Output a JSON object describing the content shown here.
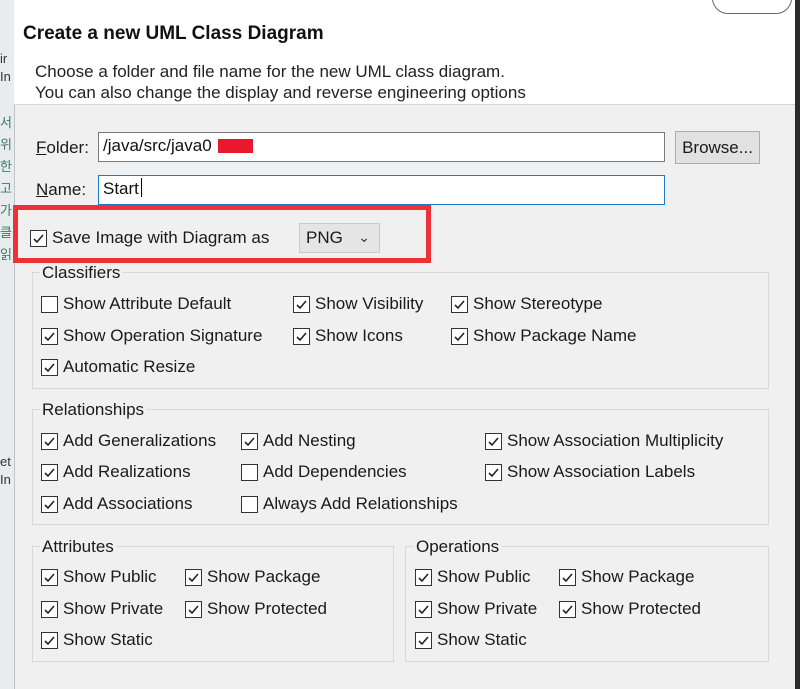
{
  "header": {
    "title": "Create a new UML Class Diagram",
    "desc_line1": "Choose a folder and file name for the new UML class diagram.",
    "desc_line2": "You can also change the display and reverse engineering options"
  },
  "folder": {
    "label_mnemonic": "F",
    "label_rest": "older:",
    "value": "/java/src/java0"
  },
  "name": {
    "label_mnemonic": "N",
    "label_rest": "ame:",
    "value": "Start"
  },
  "browse_label": "Browse...",
  "save_image": {
    "label": "Save Image with Diagram as",
    "checked": true,
    "format": "PNG"
  },
  "classifiers": {
    "title": "Classifiers",
    "items": [
      {
        "label": "Show Attribute Default",
        "checked": false
      },
      {
        "label": "Show Visibility",
        "checked": true
      },
      {
        "label": "Show Stereotype",
        "checked": true
      },
      {
        "label": "Show Operation Signature",
        "checked": true
      },
      {
        "label": "Show Icons",
        "checked": true
      },
      {
        "label": "Show Package Name",
        "checked": true
      },
      {
        "label": "Automatic Resize",
        "checked": true
      }
    ]
  },
  "relationships": {
    "title": "Relationships",
    "items": [
      {
        "label": "Add Generalizations",
        "checked": true
      },
      {
        "label": "Add Nesting",
        "checked": true
      },
      {
        "label": "Show Association Multiplicity",
        "checked": true
      },
      {
        "label": "Add Realizations",
        "checked": true
      },
      {
        "label": "Add Dependencies",
        "checked": false
      },
      {
        "label": "Show Association Labels",
        "checked": true
      },
      {
        "label": "Add Associations",
        "checked": true
      },
      {
        "label": "Always Add Relationships",
        "checked": false
      }
    ]
  },
  "attributes": {
    "title": "Attributes",
    "items": [
      {
        "label": "Show Public",
        "checked": true
      },
      {
        "label": "Show Package",
        "checked": true
      },
      {
        "label": "Show Private",
        "checked": true
      },
      {
        "label": "Show Protected",
        "checked": true
      },
      {
        "label": "Show Static",
        "checked": true
      }
    ]
  },
  "operations": {
    "title": "Operations",
    "items": [
      {
        "label": "Show Public",
        "checked": true
      },
      {
        "label": "Show Package",
        "checked": true
      },
      {
        "label": "Show Private",
        "checked": true
      },
      {
        "label": "Show Protected",
        "checked": true
      },
      {
        "label": "Show Static",
        "checked": true
      }
    ]
  },
  "background_fragments": [
    "ir",
    "In",
    "서",
    "위",
    "한",
    "고",
    "가",
    "클",
    "읽",
    "et",
    "In"
  ]
}
